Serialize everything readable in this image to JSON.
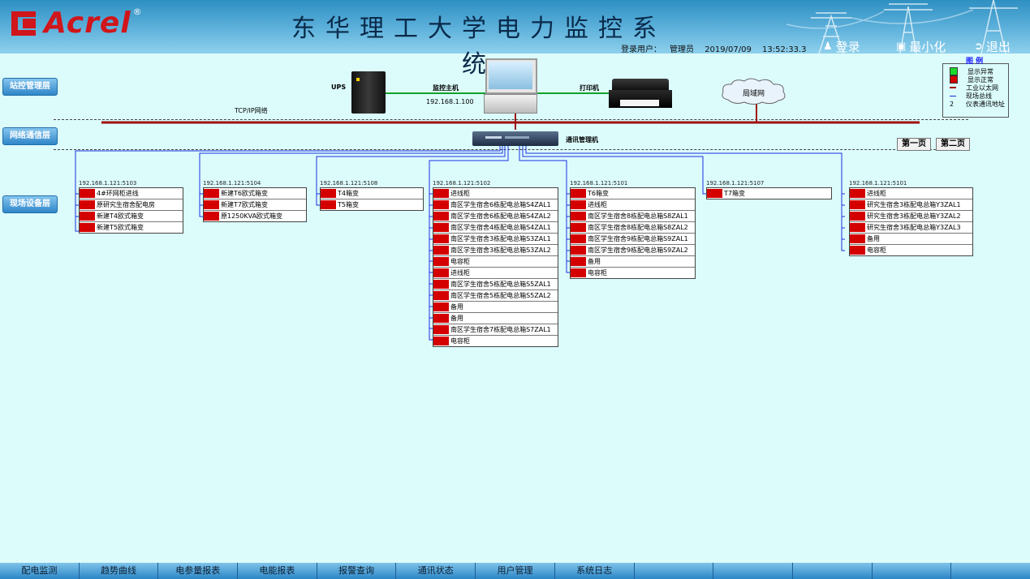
{
  "header": {
    "logo_text": "Acrel",
    "logo_reg": "®",
    "title": "东华理工大学电力监控系统",
    "user_label": "登录用户：",
    "user_name": "管理员",
    "date": "2019/07/09",
    "time": "13:52:33.3",
    "login_label": "登录",
    "minimize_label": "最小化",
    "exit_label": "退出"
  },
  "layers": {
    "station": "站控管理层",
    "network": "网络通信层",
    "field": "现场设备层"
  },
  "topology": {
    "ups": "UPS",
    "host_label": "监控主机",
    "host_ip": "192.168.1.100",
    "printer": "打印机",
    "lan": "局域网",
    "tcpip": "TCP/IP网络",
    "comm_manager": "通讯管理机"
  },
  "legend": {
    "title": "图 例",
    "abnormal": "显示异常",
    "normal": "显示正常",
    "ethernet": "工业以太网",
    "fieldbus": "现场总线",
    "addr_num": "2",
    "addr_label": "仪表通讯地址",
    "colors": {
      "abnormal": "#1adb2c",
      "normal": "#d40000",
      "ethernet": "#a01010",
      "fieldbus": "#1a2ee0"
    }
  },
  "pages": {
    "first": "第一页",
    "second": "第二页"
  },
  "devices": [
    {
      "ip": "192.168.1.121:5103",
      "items": [
        {
          "addr": "71",
          "name": "4#环网柜进线"
        },
        {
          "addr": "72",
          "name": "原研究生宿舍配电房"
        },
        {
          "addr": "73",
          "name": "新建T4欧式箱变"
        },
        {
          "addr": "74",
          "name": "新建T5欧式箱变"
        }
      ]
    },
    {
      "ip": "192.168.1.121:5104",
      "items": [
        {
          "addr": "75",
          "name": "新建T6欧式箱变"
        },
        {
          "addr": "76",
          "name": "新建T7欧式箱变"
        },
        {
          "addr": "77",
          "name": "原1250KVA欧式箱变"
        }
      ]
    },
    {
      "ip": "192.168.1.121:5108",
      "items": [
        {
          "addr": "78",
          "name": "T4箱变"
        },
        {
          "addr": "79",
          "name": "T5箱变"
        }
      ]
    },
    {
      "ip": "192.168.1.121:5102",
      "items": [
        {
          "addr": "80",
          "name": "进线柜"
        },
        {
          "addr": "81",
          "name": "南区学生宿舍6栋配电总箱S4ZAL1"
        },
        {
          "addr": "82",
          "name": "南区学生宿舍6栋配电总箱S4ZAL2"
        },
        {
          "addr": "83",
          "name": "南区学生宿舍4栋配电总箱S4ZAL1"
        },
        {
          "addr": "84",
          "name": "南区学生宿舍3栋配电总箱S3ZAL1"
        },
        {
          "addr": "85",
          "name": "南区学生宿舍3栋配电总箱S3ZAL2"
        },
        {
          "addr": "87",
          "name": "电容柜"
        },
        {
          "addr": "88",
          "name": "进线柜"
        },
        {
          "addr": "89",
          "name": "南区学生宿舍5栋配电总箱S5ZAL1"
        },
        {
          "addr": "90",
          "name": "南区学生宿舍5栋配电总箱S5ZAL2"
        },
        {
          "addr": "91",
          "name": "备用"
        },
        {
          "addr": "92",
          "name": "备用"
        },
        {
          "addr": "93",
          "name": "南区学生宿舍7栋配电总箱S7ZAL1"
        },
        {
          "addr": "94",
          "name": "电容柜"
        }
      ]
    },
    {
      "ip": "192.168.1.121:5101",
      "items": [
        {
          "addr": "97",
          "name": "T6箱变"
        },
        {
          "addr": "98",
          "name": "进线柜"
        },
        {
          "addr": "99",
          "name": "南区学生宿舍8栋配电总箱S8ZAL1"
        },
        {
          "addr": "100",
          "name": "南区学生宿舍8栋配电总箱S8ZAL2"
        },
        {
          "addr": "101",
          "name": "南区学生宿舍9栋配电总箱S9ZAL1"
        },
        {
          "addr": "102",
          "name": "南区学生宿舍9栋配电总箱S9ZAL2"
        },
        {
          "addr": "103",
          "name": "备用"
        },
        {
          "addr": "104",
          "name": "电容柜"
        }
      ]
    },
    {
      "ip": "192.168.1.121:5107",
      "items": [
        {
          "addr": "105",
          "name": "T7箱变"
        }
      ]
    },
    {
      "ip": "192.168.1.121:5101",
      "items": [
        {
          "addr": "107",
          "name": "进线柜"
        },
        {
          "addr": "108",
          "name": "研究生宿舍3栋配电总箱Y3ZAL1"
        },
        {
          "addr": "109",
          "name": "研究生宿舍3栋配电总箱Y3ZAL2"
        },
        {
          "addr": "110",
          "name": "研究生宿舍3栋配电总箱Y3ZAL3"
        },
        {
          "addr": "111",
          "name": "备用"
        },
        {
          "addr": "112",
          "name": "电容柜"
        }
      ]
    }
  ],
  "bottom_tabs": [
    "配电监测",
    "趋势曲线",
    "电参量报表",
    "电能报表",
    "报警查询",
    "通讯状态",
    "用户管理",
    "系统日志"
  ]
}
